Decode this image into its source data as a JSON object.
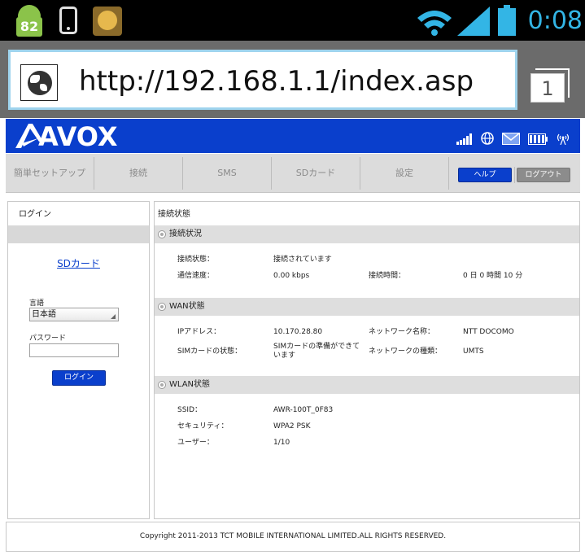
{
  "status_bar": {
    "notification_count": "82",
    "clock": "0:08",
    "icons": [
      "android-notification-icon",
      "phone-icon",
      "app-icon",
      "wifi-icon",
      "signal-icon",
      "battery-icon"
    ]
  },
  "browser": {
    "url": "http://192.168.1.1/index.asp",
    "tab_count": "1"
  },
  "header": {
    "logo": "AVOX",
    "icons": [
      "signal-bars-icon",
      "globe-icon",
      "mail-icon",
      "battery-icon",
      "wireless-tower-icon"
    ]
  },
  "nav": {
    "items": [
      {
        "label": "簡単セットアップ"
      },
      {
        "label": "接続"
      },
      {
        "label": "SMS"
      },
      {
        "label": "SDカード"
      },
      {
        "label": "設定"
      }
    ],
    "help_label": "ヘルプ",
    "logout_label": "ログアウト"
  },
  "login_panel": {
    "title": "ログイン",
    "sd_link": "SDカード",
    "language_label": "言語",
    "language_value": "日本語",
    "password_label": "パスワード",
    "password_value": "",
    "login_button": "ログイン"
  },
  "status_panel": {
    "title": "接続状態",
    "sections": {
      "connection": {
        "title": "接続状況",
        "status_label": "接続状態：",
        "status_value": "接続されています",
        "speed_label": "通信速度：",
        "speed_value": "0.00 kbps",
        "time_label": "接続時間：",
        "time_value": "0 日 0 時間 10 分"
      },
      "wan": {
        "title": "WAN状態",
        "ip_label": "IPアドレス：",
        "ip_value": "10.170.28.80",
        "network_name_label": "ネットワーク名称：",
        "network_name_value": "NTT DOCOMO",
        "sim_label": "SIMカードの状態：",
        "sim_value": "SIMカードの準備ができています",
        "network_type_label": "ネットワークの種類：",
        "network_type_value": "UMTS"
      },
      "wlan": {
        "title": "WLAN状態",
        "ssid_label": "SSID：",
        "ssid_value": "AWR-100T_0F83",
        "security_label": "セキュリティ：",
        "security_value": "WPA2 PSK",
        "users_label": "ユーザー：",
        "users_value": "1/10"
      }
    }
  },
  "footer": {
    "copyright": "Copyright 2011-2013 TCT MOBILE INTERNATIONAL LIMITED.ALL RIGHTS RESERVED."
  },
  "colors": {
    "brand_blue": "#0a3fcc",
    "status_accent": "#33b5e5"
  }
}
